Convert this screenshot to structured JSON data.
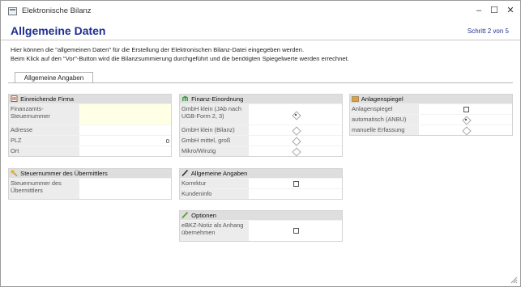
{
  "window": {
    "title": "Elektronische Bilanz",
    "minimize": "–",
    "maximize": "☐",
    "close": "✕"
  },
  "page": {
    "heading": "Allgemeine Daten",
    "step": "Schritt 2 von 5",
    "intro_line1": "Hier können die \"allgemeinen Daten\" für die Erstellung der Elektronischen Bilanz-Datei eingegeben werden.",
    "intro_line2": "Beim Klick auf den \"Vor\"-Button wird die Bilanzsummierung durchgeführt und die benötigten Spiegelwerte werden errechnet."
  },
  "tab": {
    "label": "Allgemeine Angaben"
  },
  "firma": {
    "title": "Einreichende Firma",
    "rows": [
      {
        "label": "Finanzamts-Steuernummer",
        "value": ""
      },
      {
        "label": "Adresse",
        "value": ""
      },
      {
        "label": "PLZ",
        "value": "0"
      },
      {
        "label": "Ort",
        "value": ""
      }
    ]
  },
  "uebermittler": {
    "title": "Steuernummer des Übermittlers",
    "rows": [
      {
        "label": "Steuernummer des Übermittlers",
        "value": ""
      }
    ]
  },
  "finanz": {
    "title": "Finanz-Einordnung",
    "rows": [
      {
        "label": "GmbH klein (JAb nach UGB-Form 2, 3)",
        "selected": true
      },
      {
        "label": "GmbH klein (Bilanz)",
        "selected": false
      },
      {
        "label": "GmbH mittel, groß",
        "selected": false
      },
      {
        "label": "Mikro/Winzig",
        "selected": false
      }
    ]
  },
  "allgemein": {
    "title": "Allgemeine Angaben",
    "rows": [
      {
        "label": "Korrektur",
        "checked": false
      },
      {
        "label": "Kundeninfo",
        "value": ""
      }
    ]
  },
  "optionen": {
    "title": "Optionen",
    "rows": [
      {
        "label": "eBKZ-Notiz als Anhang übernehmen",
        "checked": false
      }
    ]
  },
  "anlagen": {
    "title": "Anlagenspiegel",
    "rows": [
      {
        "label": "Anlagenspiegel",
        "checked": false
      },
      {
        "label": "automatisch (ANBU)",
        "selected": true
      },
      {
        "label": "manuelle Erfassung",
        "selected": false
      }
    ]
  },
  "icons": {
    "firma": "document-icon",
    "uebermittler": "key-icon",
    "finanz": "bank-icon",
    "allgemein": "pen-icon",
    "optionen": "pencil-icon",
    "anlagen": "folder-icon",
    "resize": "resize-grip-icon"
  },
  "colors": {
    "heading": "#1e2f8f",
    "panel_header": "#dedede",
    "input_highlight": "#ffffe6"
  }
}
